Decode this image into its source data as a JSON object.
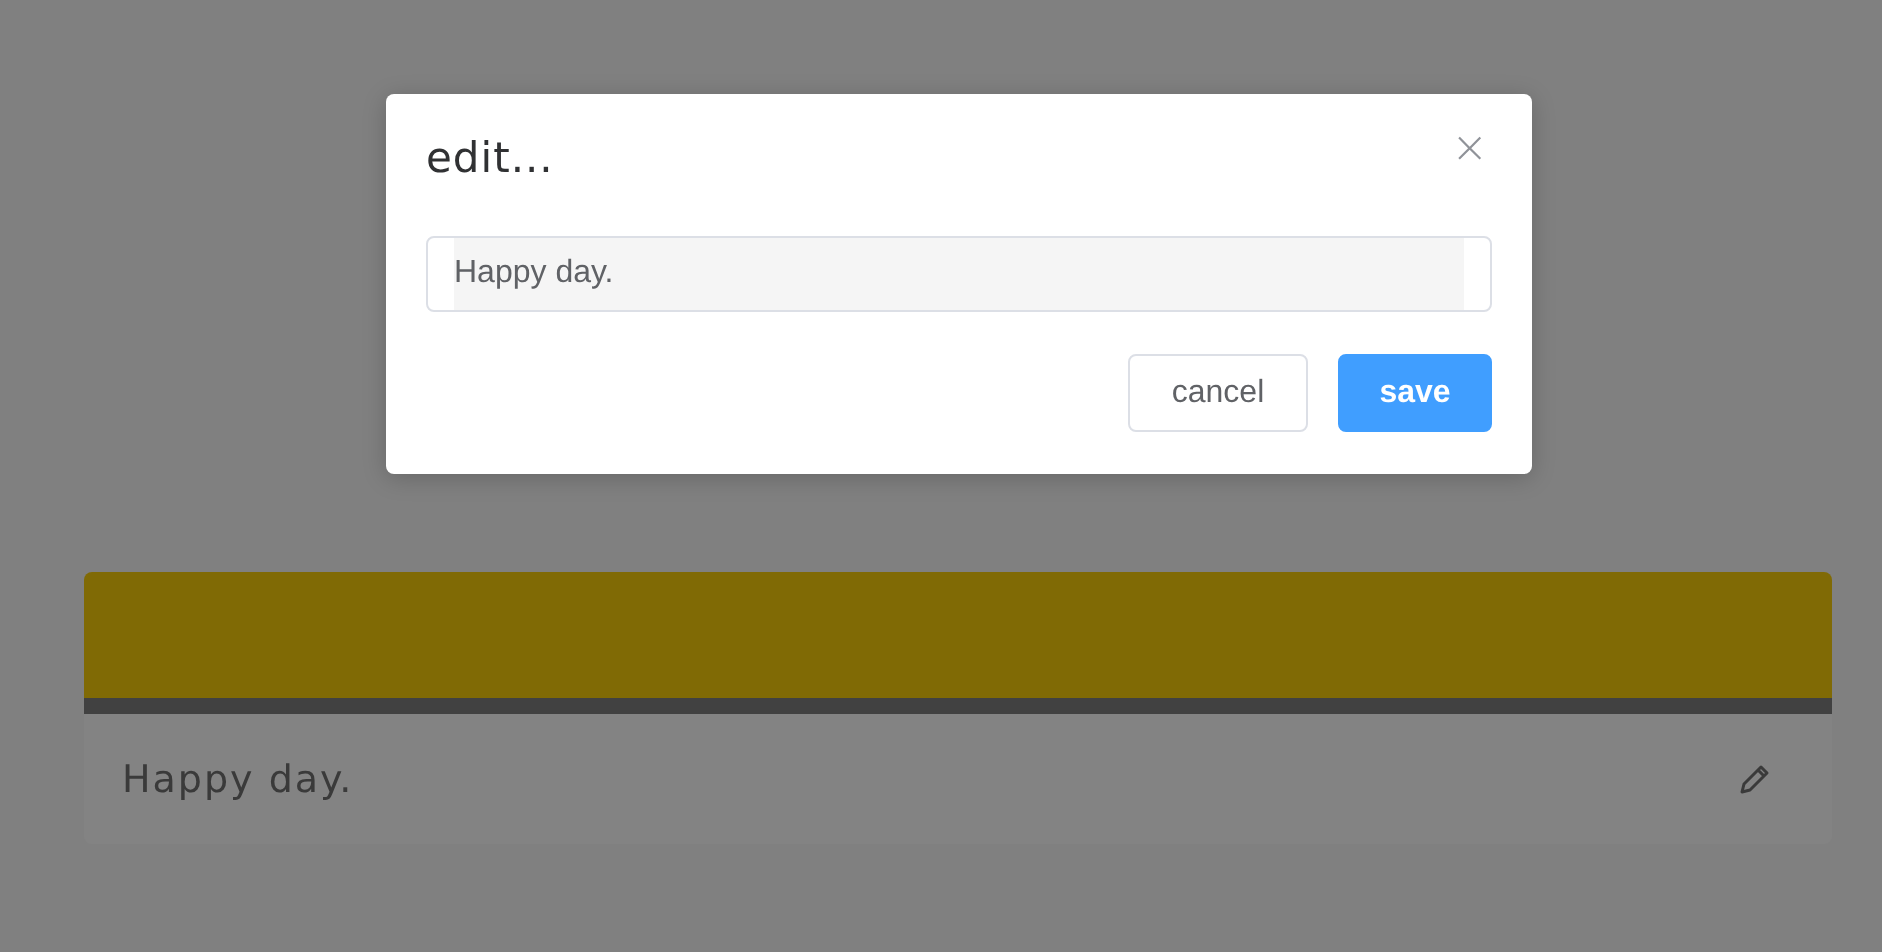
{
  "dialog": {
    "title": "edit...",
    "close": "×",
    "input": {
      "value": "Happy day."
    },
    "buttons": [
      {
        "label": "cancel",
        "kind": "secondary"
      },
      {
        "label": "save",
        "kind": "primary"
      }
    ]
  },
  "card": {
    "text": "Happy day."
  }
}
